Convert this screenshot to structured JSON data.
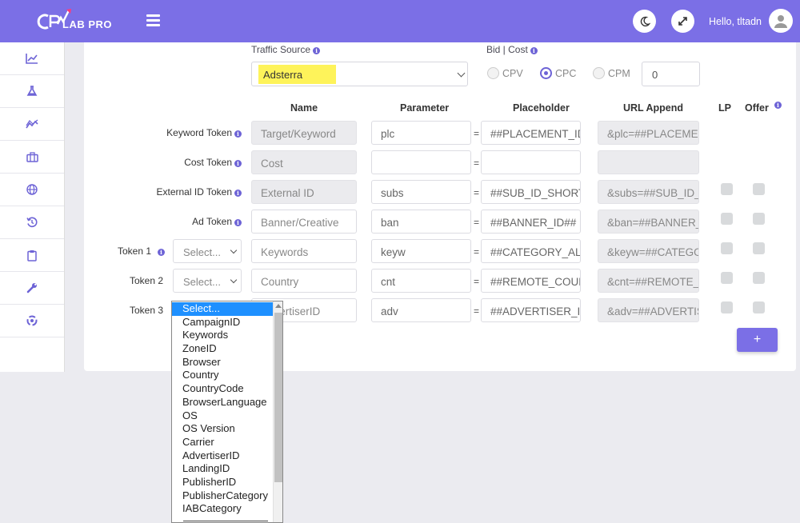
{
  "header": {
    "logo_text": "LAB PRO",
    "greeting": "Hello, tltadn",
    "icons": [
      "menu-icon",
      "moon-icon",
      "expand-icon",
      "user-icon"
    ],
    "accent_color": "#7b6fe6"
  },
  "sidebar": {
    "items": [
      {
        "icon": "chart-line-icon"
      },
      {
        "icon": "flask-icon"
      },
      {
        "icon": "trend-icon"
      },
      {
        "icon": "briefcase-icon"
      },
      {
        "icon": "globe-icon"
      },
      {
        "icon": "history-icon"
      },
      {
        "icon": "clipboard-icon"
      },
      {
        "icon": "wrench-icon"
      },
      {
        "icon": "target-icon"
      }
    ]
  },
  "traffic_source": {
    "label": "Traffic Source",
    "value": "Adsterra"
  },
  "bid": {
    "label": "Bid | Cost",
    "options": [
      "CPV",
      "CPC",
      "CPM"
    ],
    "selected": "CPC",
    "value": "0"
  },
  "columns": {
    "name": "Name",
    "parameter": "Parameter",
    "placeholder": "Placeholder",
    "url_append": "URL Append",
    "lp": "LP",
    "offer": "Offer"
  },
  "rows": [
    {
      "label": "Keyword Token",
      "name": "Target/Keyword",
      "parameter": "plc",
      "placeholder": "##PLACEMENT_ID##",
      "url_append": "&plc=##PLACEMENT_ID##"
    },
    {
      "label": "Cost Token",
      "name": "Cost",
      "parameter": "",
      "placeholder": "",
      "url_append": ""
    },
    {
      "label": "External ID Token",
      "name": "External ID",
      "parameter": "subs",
      "placeholder": "##SUB_ID_SHORT##",
      "url_append": "&subs=##SUB_ID_SHORT##"
    },
    {
      "label": "Ad Token",
      "name": "Banner/Creative",
      "parameter": "ban",
      "placeholder": "##BANNER_ID##",
      "url_append": "&ban=##BANNER_ID##"
    },
    {
      "label": "Token 1",
      "select": "Select...",
      "name": "Keywords",
      "parameter": "keyw",
      "placeholder": "##CATEGORY_ALIAS##",
      "url_append": "&keyw=##CATEGORY_ALIAS##"
    },
    {
      "label": "Token 2",
      "select": "Select...",
      "name": "Country",
      "parameter": "cnt",
      "placeholder": "##REMOTE_COUNTRY##",
      "url_append": "&cnt=##REMOTE_COUNTRY##"
    },
    {
      "label": "Token 3",
      "name": "AdvertiserID",
      "parameter": "adv",
      "placeholder": "##ADVERTISER_ID##",
      "url_append": "&adv=##ADVERTISER_ID##"
    }
  ],
  "add_button": "+",
  "dropdown": {
    "options": [
      "Select...",
      "CampaignID",
      "Keywords",
      "ZoneID",
      "Browser",
      "Country",
      "CountryCode",
      "BrowserLanguage",
      "OS",
      "OS Version",
      "Carrier",
      "AdvertiserID",
      "LandingID",
      "PublisherID",
      "PublisherCategory",
      "IABCategory"
    ],
    "highlighted": "Select..."
  }
}
